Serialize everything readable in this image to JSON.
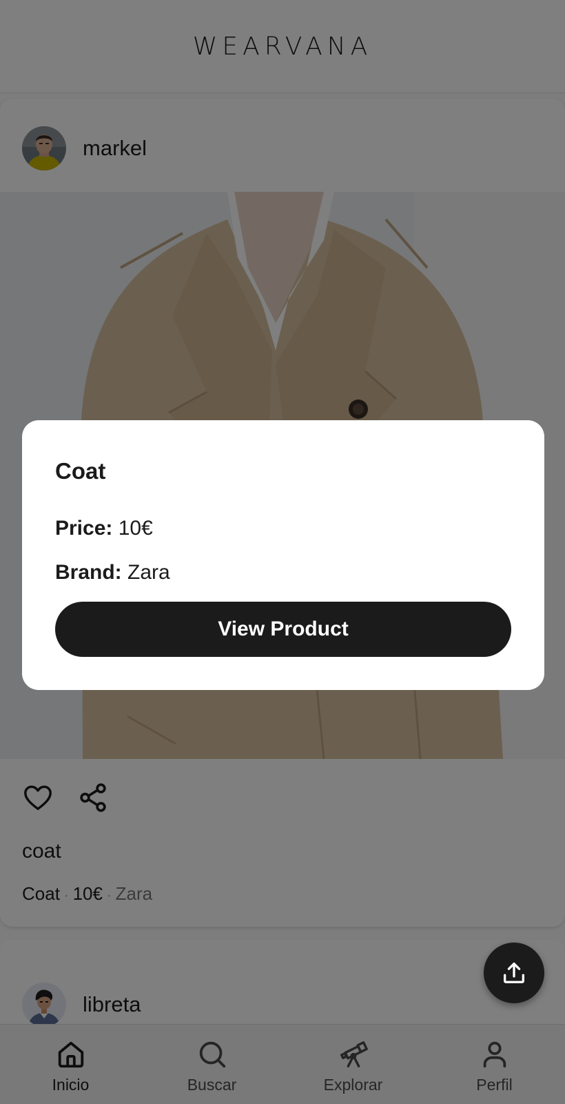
{
  "app": {
    "name": "WEARVANA"
  },
  "feed": {
    "posts": [
      {
        "username": "markel",
        "caption": "coat",
        "item": {
          "name": "Coat",
          "price": "10€",
          "brand": "Zara"
        }
      },
      {
        "username": "libreta"
      }
    ]
  },
  "modal": {
    "title": "Coat",
    "price_key": "Price:",
    "price_value": "10€",
    "brand_key": "Brand:",
    "brand_value": "Zara",
    "button_label": "View Product"
  },
  "bottom_nav": {
    "items": [
      {
        "label": "Inicio",
        "icon": "home-icon",
        "active": true
      },
      {
        "label": "Buscar",
        "icon": "search-icon",
        "active": false
      },
      {
        "label": "Explorar",
        "icon": "telescope-icon",
        "active": false
      },
      {
        "label": "Perfil",
        "icon": "user-icon",
        "active": false
      }
    ]
  },
  "fab": {
    "icon": "upload-icon"
  },
  "colors": {
    "primary": "#1b1b1b",
    "surface": "#ffffff",
    "scrim": "rgba(0,0,0,0.5)",
    "muted": "#777777"
  }
}
